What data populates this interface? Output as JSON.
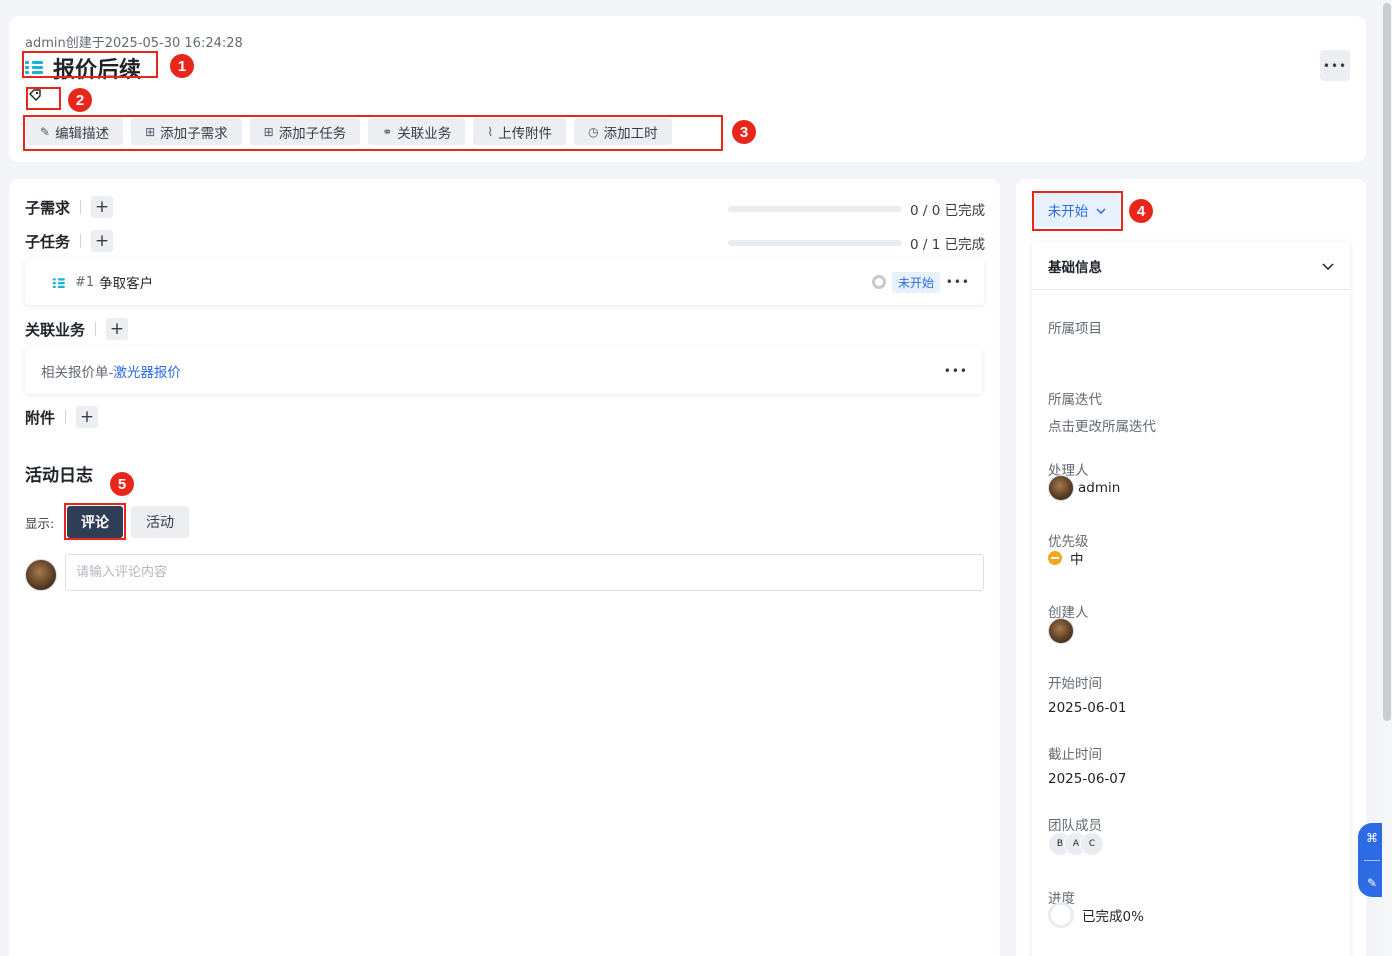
{
  "header": {
    "meta": "admin创建于2025-05-30 16:24:28",
    "title": "报价后续",
    "actions": [
      {
        "label": "编辑描述",
        "icon": "edit-icon"
      },
      {
        "label": "添加子需求",
        "icon": "plus-square-icon"
      },
      {
        "label": "添加子任务",
        "icon": "plus-square-icon"
      },
      {
        "label": "关联业务",
        "icon": "link-icon"
      },
      {
        "label": "上传附件",
        "icon": "paperclip-icon"
      },
      {
        "label": "添加工时",
        "icon": "clock-icon"
      }
    ],
    "more_label": "•••"
  },
  "annotations": [
    "1",
    "2",
    "3",
    "4",
    "5"
  ],
  "main": {
    "subreq": {
      "title": "子需求",
      "progress_text": "0 / 0 已完成",
      "progress": 0
    },
    "subtask": {
      "title": "子任务",
      "progress_text": "0 / 1 已完成",
      "progress": 0
    },
    "task_item": {
      "id": "#1",
      "name": "争取客户",
      "status": "未开始",
      "more": "•••"
    },
    "linked": {
      "title": "关联业务"
    },
    "linked_item": {
      "prefix": "相关报价单-",
      "link": "激光器报价",
      "more": "•••"
    },
    "attach": {
      "title": "附件"
    },
    "log": {
      "title": "活动日志",
      "filter_label": "显示:",
      "tabs": [
        {
          "label": "评论",
          "active": true
        },
        {
          "label": "活动",
          "active": false
        }
      ],
      "comment_placeholder": "请输入评论内容"
    },
    "plus": "+"
  },
  "side": {
    "status": "未开始",
    "section_title": "基础信息",
    "fields": {
      "project_label": "所属项目",
      "iteration_label": "所属迭代",
      "iteration_value": "点击更改所属迭代",
      "assignee_label": "处理人",
      "assignee_value": "admin",
      "priority_label": "优先级",
      "priority_value": "中",
      "creator_label": "创建人",
      "start_label": "开始时间",
      "start_value": "2025-06-01",
      "end_label": "截止时间",
      "end_value": "2025-06-07",
      "team_label": "团队成员",
      "team_members": [
        "B",
        "A",
        "C"
      ],
      "progress_label": "进度",
      "progress_value": "已完成0%",
      "progress": 0
    }
  },
  "colors": {
    "accent": "#2d6be4",
    "annotation": "#e8261c",
    "priority_medium": "#f5a623",
    "list_icon": "#17b3d6"
  }
}
